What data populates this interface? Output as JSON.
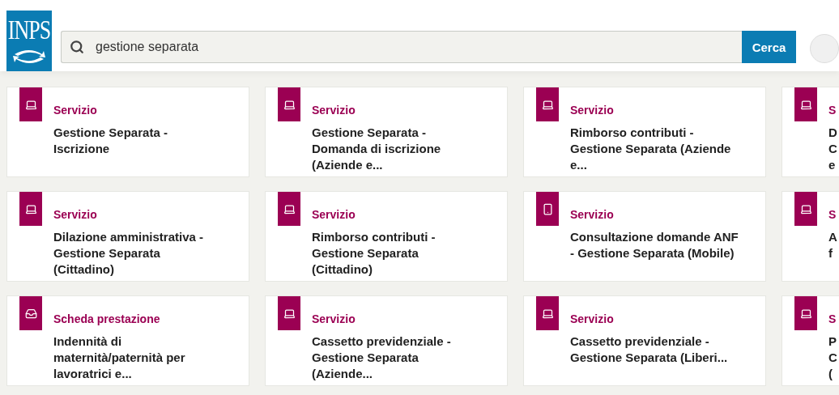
{
  "logo": {
    "text": "INPS"
  },
  "search": {
    "value": "gestione separata",
    "button": "Cerca"
  },
  "results": [
    {
      "kind": "desktop",
      "category": "Servizio",
      "lines": [
        "Gestione Separata -",
        "Iscrizione"
      ]
    },
    {
      "kind": "desktop",
      "category": "Servizio",
      "lines": [
        "Gestione Separata -",
        "Domanda di iscrizione",
        "(Aziende e..."
      ]
    },
    {
      "kind": "desktop",
      "category": "Servizio",
      "lines": [
        "Rimborso contributi -",
        "Gestione Separata (Aziende",
        "e..."
      ]
    },
    {
      "kind": "desktop",
      "category": "S",
      "lines": [
        "D",
        "C",
        "e"
      ]
    },
    {
      "kind": "desktop",
      "category": "Servizio",
      "lines": [
        "Dilazione amministrativa -",
        "Gestione Separata",
        "(Cittadino)"
      ]
    },
    {
      "kind": "desktop",
      "category": "Servizio",
      "lines": [
        "Rimborso contributi -",
        "Gestione Separata",
        "(Cittadino)"
      ]
    },
    {
      "kind": "mobile",
      "category": "Servizio",
      "lines": [
        "Consultazione domande ANF",
        "- Gestione Separata (Mobile)"
      ]
    },
    {
      "kind": "desktop",
      "category": "S",
      "lines": [
        "A",
        "f"
      ]
    },
    {
      "kind": "sheet",
      "category": "Scheda prestazione",
      "lines": [
        "Indennità di",
        "maternità/paternità per",
        "lavoratrici e..."
      ]
    },
    {
      "kind": "desktop",
      "category": "Servizio",
      "lines": [
        "Cassetto previdenziale -",
        "Gestione Separata",
        "(Aziende..."
      ]
    },
    {
      "kind": "desktop",
      "category": "Servizio",
      "lines": [
        "Cassetto previdenziale -",
        "Gestione Separata (Liberi..."
      ]
    },
    {
      "kind": "desktop",
      "category": "S",
      "lines": [
        "P",
        "C",
        "("
      ]
    }
  ]
}
